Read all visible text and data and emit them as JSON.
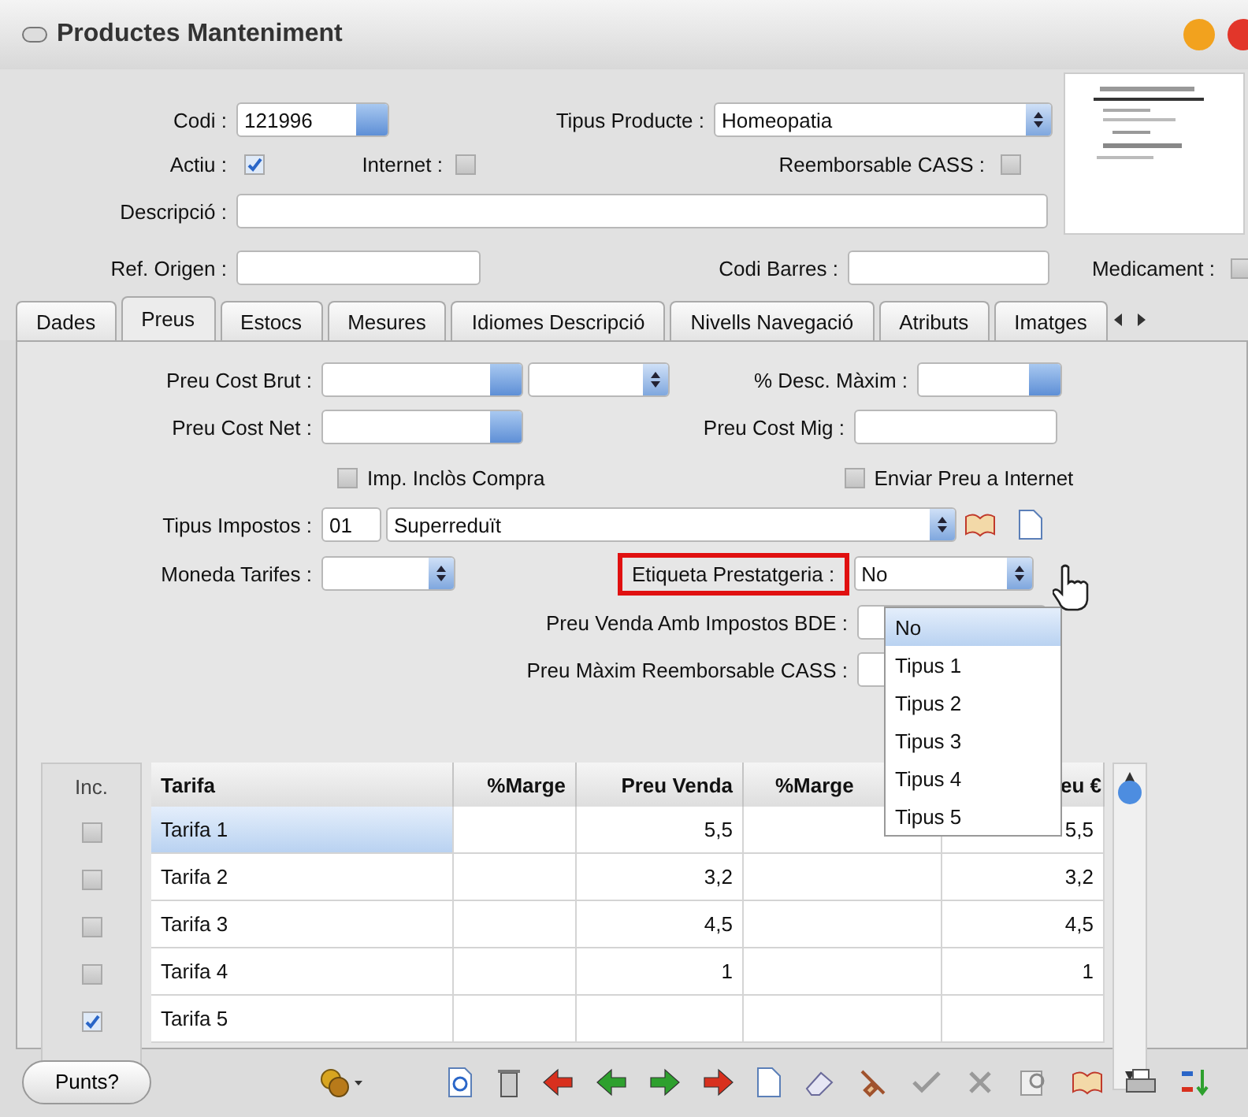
{
  "window": {
    "title": "Productes Manteniment"
  },
  "header": {
    "codi": {
      "label": "Codi :",
      "value": "121996"
    },
    "tipus_producte": {
      "label": "Tipus Producte :",
      "value": "Homeopatia"
    },
    "actiu": {
      "label": "Actiu :",
      "checked": true
    },
    "internet": {
      "label": "Internet :",
      "checked": false
    },
    "reemborsable": {
      "label": "Reemborsable CASS :",
      "checked": false
    },
    "descripcio": {
      "label": "Descripció :"
    },
    "ref_origen": {
      "label": "Ref. Origen :"
    },
    "codi_barres": {
      "label": "Codi Barres :"
    },
    "medicament": {
      "label": "Medicament :",
      "checked": false
    }
  },
  "tabs": [
    {
      "label": "Dades",
      "selected": false
    },
    {
      "label": "Preus",
      "selected": true
    },
    {
      "label": "Estocs",
      "selected": false
    },
    {
      "label": "Mesures",
      "selected": false
    },
    {
      "label": "Idiomes Descripció",
      "selected": false
    },
    {
      "label": "Nivells Navegació",
      "selected": false
    },
    {
      "label": "Atributs",
      "selected": false
    },
    {
      "label": "Imatges",
      "selected": false
    }
  ],
  "form": {
    "preu_cost_brut": {
      "label": "Preu Cost Brut :"
    },
    "desc_maxim": {
      "label": "% Desc. Màxim :"
    },
    "preu_cost_net": {
      "label": "Preu Cost Net :"
    },
    "preu_cost_mig": {
      "label": "Preu Cost Mig :"
    },
    "imp_inclos": {
      "label": "Imp. Inclòs Compra",
      "checked": false
    },
    "enviar_preu": {
      "label": "Enviar Preu a Internet",
      "checked": false
    },
    "tipus_impostos": {
      "label": "Tipus Impostos :",
      "code": "01",
      "value": "Superreduït"
    },
    "moneda_tarifes": {
      "label": "Moneda Tarifes :"
    },
    "etiqueta": {
      "label": "Etiqueta Prestatgeria :",
      "value": "No",
      "highlighted": true
    },
    "preu_venda_bde": {
      "label": "Preu Venda Amb Impostos BDE :"
    },
    "preu_maxim": {
      "label": "Preu Màxim Reemborsable CASS :"
    }
  },
  "dropdown": {
    "options": [
      {
        "label": "No",
        "selected": true
      },
      {
        "label": "Tipus 1",
        "selected": false
      },
      {
        "label": "Tipus 2",
        "selected": false
      },
      {
        "label": "Tipus 3",
        "selected": false
      },
      {
        "label": "Tipus 4",
        "selected": false
      },
      {
        "label": "Tipus 5",
        "selected": false
      }
    ]
  },
  "table": {
    "inc_label": "Inc.",
    "columns": [
      "Tarifa",
      "%Marge",
      "Preu Venda",
      "%Marge",
      "eu €"
    ],
    "rows": [
      {
        "inc": false,
        "selected": true,
        "cells": [
          "Tarifa 1",
          "",
          "5,5",
          "",
          "5,5"
        ]
      },
      {
        "inc": false,
        "selected": false,
        "cells": [
          "Tarifa 2",
          "",
          "3,2",
          "",
          "3,2"
        ]
      },
      {
        "inc": false,
        "selected": false,
        "cells": [
          "Tarifa 3",
          "",
          "4,5",
          "",
          "4,5"
        ]
      },
      {
        "inc": false,
        "selected": false,
        "cells": [
          "Tarifa 4",
          "",
          "1",
          "",
          "1"
        ]
      },
      {
        "inc": true,
        "selected": false,
        "cells": [
          "Tarifa 5",
          "",
          "",
          "",
          ""
        ]
      }
    ]
  },
  "toolbar": {
    "punts": "Punts?"
  }
}
